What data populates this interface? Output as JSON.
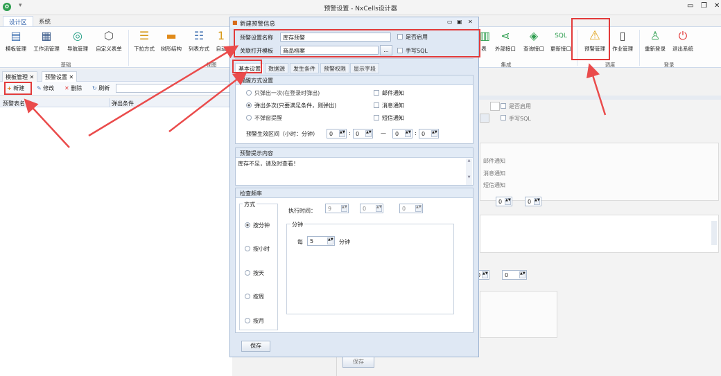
{
  "window": {
    "title": "预警设置 - NxCells设计器"
  },
  "ribbon": {
    "tabs": [
      "设计区",
      "系统"
    ],
    "buttons": [
      {
        "label": "模板管理",
        "icon": "template-icon"
      },
      {
        "label": "工作流管理",
        "icon": "workflow-icon"
      },
      {
        "label": "导航管理",
        "icon": "compass-icon"
      },
      {
        "label": "自定义表单",
        "icon": "cube-icon"
      },
      {
        "label": "下拉方式",
        "icon": "dropdown-icon"
      },
      {
        "label": "树形结构",
        "icon": "tree-icon"
      },
      {
        "label": "列表方式",
        "icon": "list-icon"
      },
      {
        "label": "自动",
        "icon": "auto-icon"
      },
      {
        "label": "表",
        "icon": "table-icon"
      },
      {
        "label": "外部接口",
        "icon": "share-icon"
      },
      {
        "label": "查询接口",
        "icon": "query-icon"
      },
      {
        "label": "更新接口",
        "icon": "sql-icon"
      },
      {
        "label": "预警管理",
        "icon": "warning-icon"
      },
      {
        "label": "作业管理",
        "icon": "clipboard-icon"
      },
      {
        "label": "重新登录",
        "icon": "user-icon"
      },
      {
        "label": "退出系统",
        "icon": "power-icon"
      }
    ],
    "groups": [
      "基础",
      "视图",
      "集成",
      "调度",
      "登录"
    ]
  },
  "doctabs": [
    "模板管理",
    "预警设置"
  ],
  "toolbar": {
    "new": "新建",
    "edit": "修改",
    "delete": "删除",
    "refresh": "刷新"
  },
  "grid": {
    "columns": [
      "预警表名",
      "弹出条件"
    ]
  },
  "bg": {
    "enabled": "是否启用",
    "manual_sql": "手写SQL",
    "email": "邮件通知",
    "message": "消息通知",
    "sms": "短信通知",
    "spin1": "0",
    "spin2": "0",
    "spin3": "0",
    "spin4": "0",
    "save": "保存"
  },
  "dialog": {
    "title": "新建预警信息",
    "name_label": "预警设置名称",
    "name_value": "库存预警",
    "enabled_label": "是否启用",
    "template_label": "关联打开模板",
    "template_value": "商品档案",
    "browse": "...",
    "manual_sql": "手写SQL",
    "tabs": [
      "基本设置",
      "数据源",
      "发生条件",
      "预警权限",
      "显示字段"
    ],
    "remind": {
      "header": "提醒方式设置",
      "opt1": "只弹出一次(在登录时弹出)",
      "opt2": "弹出多次(只要满足条件，则弹出)",
      "opt3": "不弹窗提醒",
      "email": "邮件通知",
      "message": "消息通知",
      "sms": "短信通知",
      "range_label": "预警生效区间（小时：分钟）",
      "h1": "0",
      "m1": "0",
      "h2": "0",
      "m2": "0"
    },
    "content": {
      "header": "预警提示内容",
      "text": "库存不足，请及时查看！"
    },
    "freq": {
      "header": "检查频率",
      "mode_label": "方式",
      "minute": "按分钟",
      "hour": "按小时",
      "day": "按天",
      "week": "按周",
      "month": "按月",
      "exec_label": "执行时间：",
      "e1": "9",
      "e2": "0",
      "e3": "0",
      "minute_box": "分钟",
      "every": "每",
      "every_val": "5",
      "unit": "分钟"
    },
    "save": "保存"
  }
}
